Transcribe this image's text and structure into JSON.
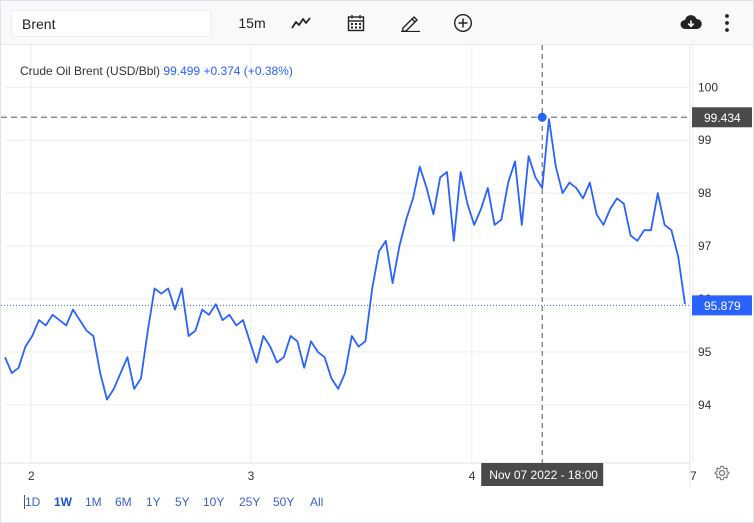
{
  "toolbar": {
    "symbol": "Brent",
    "interval": "15m",
    "icons": [
      "line-chart-icon",
      "calendar-icon",
      "pencil-icon",
      "add-indicator-icon",
      "download-icon",
      "more-icon"
    ]
  },
  "legend": {
    "name": "Crude Oil Brent (USD/Bbl)",
    "price": "99.499",
    "change": "+0.374 (+0.38%)"
  },
  "crosshair_label": "Nov 07 2022 - 18:00",
  "price_labels": {
    "crosshair": "99.434",
    "last": "95.879"
  },
  "colors": {
    "line": "#2962ff",
    "price_badge_dark": "#4a4a4a",
    "price_badge_last": "#2962ff"
  },
  "ranges": [
    "1D",
    "1W",
    "1M",
    "6M",
    "1Y",
    "5Y",
    "10Y",
    "25Y",
    "50Y",
    "All"
  ],
  "active_range": "1W",
  "chart_data": {
    "type": "line",
    "title": "Crude Oil Brent (USD/Bbl)",
    "xlabel": "",
    "ylabel": "",
    "x_ticks": [
      "2",
      "3",
      "4",
      "7"
    ],
    "y_ticks": [
      94,
      95,
      96,
      97,
      98,
      99,
      100
    ],
    "ylim": [
      92.9,
      100.8
    ],
    "grid": true,
    "series": [
      {
        "x": [
          0,
          0.2,
          0.4,
          0.6,
          0.8,
          1.0,
          1.2,
          1.4,
          1.6,
          1.8,
          2.0,
          2.2,
          2.4,
          2.6,
          2.8,
          3.0,
          3.2,
          3.4,
          3.6,
          3.8,
          4.0,
          4.2,
          4.4,
          4.6,
          4.8,
          5.0,
          5.2,
          5.4,
          5.6,
          5.8,
          6.0,
          6.2,
          6.4,
          6.6,
          6.8,
          7.0,
          7.2,
          7.4,
          7.6,
          7.8,
          8.0,
          8.2,
          8.4,
          8.6,
          8.8,
          9.0,
          9.2,
          9.4,
          9.6,
          9.8,
          10.0,
          10.2,
          10.4,
          10.6,
          10.8,
          11.0,
          11.2,
          11.4,
          11.6,
          11.8,
          12.0,
          12.2,
          12.4,
          12.6,
          12.8,
          13.0,
          13.2,
          13.4,
          13.6,
          13.8,
          14.0,
          14.2,
          14.4,
          14.6,
          14.8,
          15.0,
          15.2,
          15.4,
          15.6,
          15.8,
          16.0,
          16.2,
          16.4,
          16.6,
          16.8,
          17.0,
          17.2,
          17.4,
          17.6,
          17.8,
          18.0,
          18.2,
          18.4,
          18.6,
          18.8,
          19.0,
          19.2,
          19.4,
          19.6,
          19.8,
          20.0
        ],
        "values": [
          94.9,
          94.6,
          94.7,
          95.1,
          95.3,
          95.6,
          95.5,
          95.7,
          95.6,
          95.5,
          95.8,
          95.6,
          95.4,
          95.3,
          94.6,
          94.1,
          94.3,
          94.6,
          94.9,
          94.3,
          94.5,
          95.4,
          96.2,
          96.1,
          96.2,
          95.8,
          96.2,
          95.3,
          95.4,
          95.8,
          95.7,
          95.9,
          95.6,
          95.7,
          95.5,
          95.6,
          95.2,
          94.8,
          95.3,
          95.1,
          94.8,
          94.9,
          95.3,
          95.2,
          94.7,
          95.2,
          95.0,
          94.9,
          94.5,
          94.3,
          94.6,
          95.3,
          95.1,
          95.2,
          96.2,
          96.9,
          97.1,
          96.3,
          97.0,
          97.5,
          97.9,
          98.5,
          98.1,
          97.6,
          98.3,
          98.4,
          97.1,
          98.4,
          97.8,
          97.4,
          97.7,
          98.1,
          97.4,
          97.5,
          98.2,
          98.6,
          97.4,
          98.7,
          98.3,
          98.1,
          99.4,
          98.5,
          98.0,
          98.2,
          98.1,
          97.9,
          98.2,
          97.6,
          97.4,
          97.7,
          97.9,
          97.8,
          97.2,
          97.1,
          97.3,
          97.3,
          98.0,
          97.4,
          97.3,
          96.8,
          95.9
        ]
      }
    ],
    "crosshair": {
      "x": 15.8,
      "y": 99.434
    },
    "last_value": 95.879,
    "legend_placement": "top-left"
  }
}
